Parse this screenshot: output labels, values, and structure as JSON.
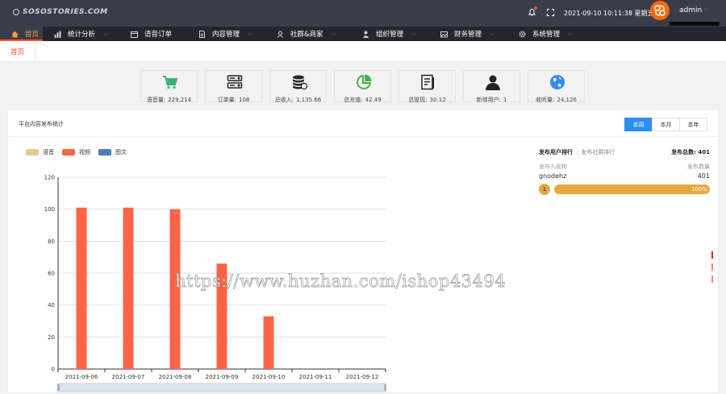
{
  "header": {
    "logo_text": "SOSOSTORIES.COM",
    "datetime": "2021-09-10 10:11:38 星期五",
    "username": "admin",
    "notification_icon": "bell-icon",
    "fullscreen_icon": "fullscreen-icon",
    "caret": "⌵"
  },
  "nav": [
    {
      "label": "首页",
      "icon": "home-icon",
      "active": true,
      "dropdown": false
    },
    {
      "label": "统计分析",
      "icon": "bar-chart-icon",
      "active": false,
      "dropdown": true
    },
    {
      "label": "语音订单",
      "icon": "calendar-icon",
      "active": false,
      "dropdown": false
    },
    {
      "label": "内容管理",
      "icon": "document-icon",
      "active": false,
      "dropdown": true
    },
    {
      "label": "社群&商家",
      "icon": "users-icon",
      "active": false,
      "dropdown": true
    },
    {
      "label": "组织管理",
      "icon": "user-icon",
      "active": false,
      "dropdown": true
    },
    {
      "label": "财务管理",
      "icon": "image-icon",
      "active": false,
      "dropdown": true
    },
    {
      "label": "系统管理",
      "icon": "gear-icon",
      "active": false,
      "dropdown": true
    }
  ],
  "tabs": {
    "home": "首页"
  },
  "stats": [
    {
      "label": "语音量:",
      "value": "229,214",
      "icon": "cart-icon",
      "color": "#3cb371"
    },
    {
      "label": "订单量:",
      "value": "108",
      "icon": "server-icon",
      "color": "#222222"
    },
    {
      "label": "总收入:",
      "value": "1,135.66",
      "icon": "coins-icon",
      "color": "#222222"
    },
    {
      "label": "总充值:",
      "value": "42.49",
      "icon": "pie-icon",
      "color": "#4caf50"
    },
    {
      "label": "总提现:",
      "value": "30.12",
      "icon": "report-icon",
      "color": "#222222"
    },
    {
      "label": "新增用户:",
      "value": "1",
      "icon": "person-icon",
      "color": "#222222"
    },
    {
      "label": "收听量:",
      "value": "24,126",
      "icon": "globe-icon",
      "color": "#2f8cf5"
    }
  ],
  "panel": {
    "title": "平台内容发布统计",
    "period_buttons": [
      {
        "label": "本周",
        "active": true
      },
      {
        "label": "本月",
        "active": false
      },
      {
        "label": "本年",
        "active": false
      }
    ]
  },
  "chart_data": {
    "type": "bar",
    "title": "",
    "xlabel": "",
    "ylabel": "",
    "ylim": [
      0,
      120
    ],
    "yticks": [
      0,
      20,
      40,
      60,
      80,
      100,
      120
    ],
    "grid": true,
    "legend_position": "top-left",
    "categories": [
      "2021-09-06",
      "2021-09-07",
      "2021-09-08",
      "2021-09-09",
      "2021-09-10",
      "2021-09-11",
      "2021-09-12"
    ],
    "series": [
      {
        "name": "语音",
        "color": "#e5c98f",
        "values": [
          0,
          0,
          0,
          0,
          0,
          0,
          0
        ]
      },
      {
        "name": "视频",
        "color": "#ff6347",
        "values": [
          101,
          101,
          100,
          66,
          33,
          0,
          0
        ]
      },
      {
        "name": "图文",
        "color": "#4a7ebb",
        "values": [
          0,
          0,
          0,
          0,
          0,
          0,
          0
        ]
      }
    ]
  },
  "ranking": {
    "tab_active": "发布用户排行",
    "tab_inactive": "发布社群排行",
    "total_label": "发布总数: 401",
    "col_name": "发布人昵称",
    "col_count": "发布数量",
    "rows": [
      {
        "rank": "1",
        "name": "gnodehz",
        "count": "401",
        "percent_label": "100%",
        "fraction": 1.0
      }
    ]
  },
  "watermark": "https://www.huzhan.com/ishop43494",
  "colors": {
    "accent": "#ff5722",
    "primary": "#2f8cf5",
    "nav_bg": "#23262e",
    "top_bg": "#393d49"
  }
}
